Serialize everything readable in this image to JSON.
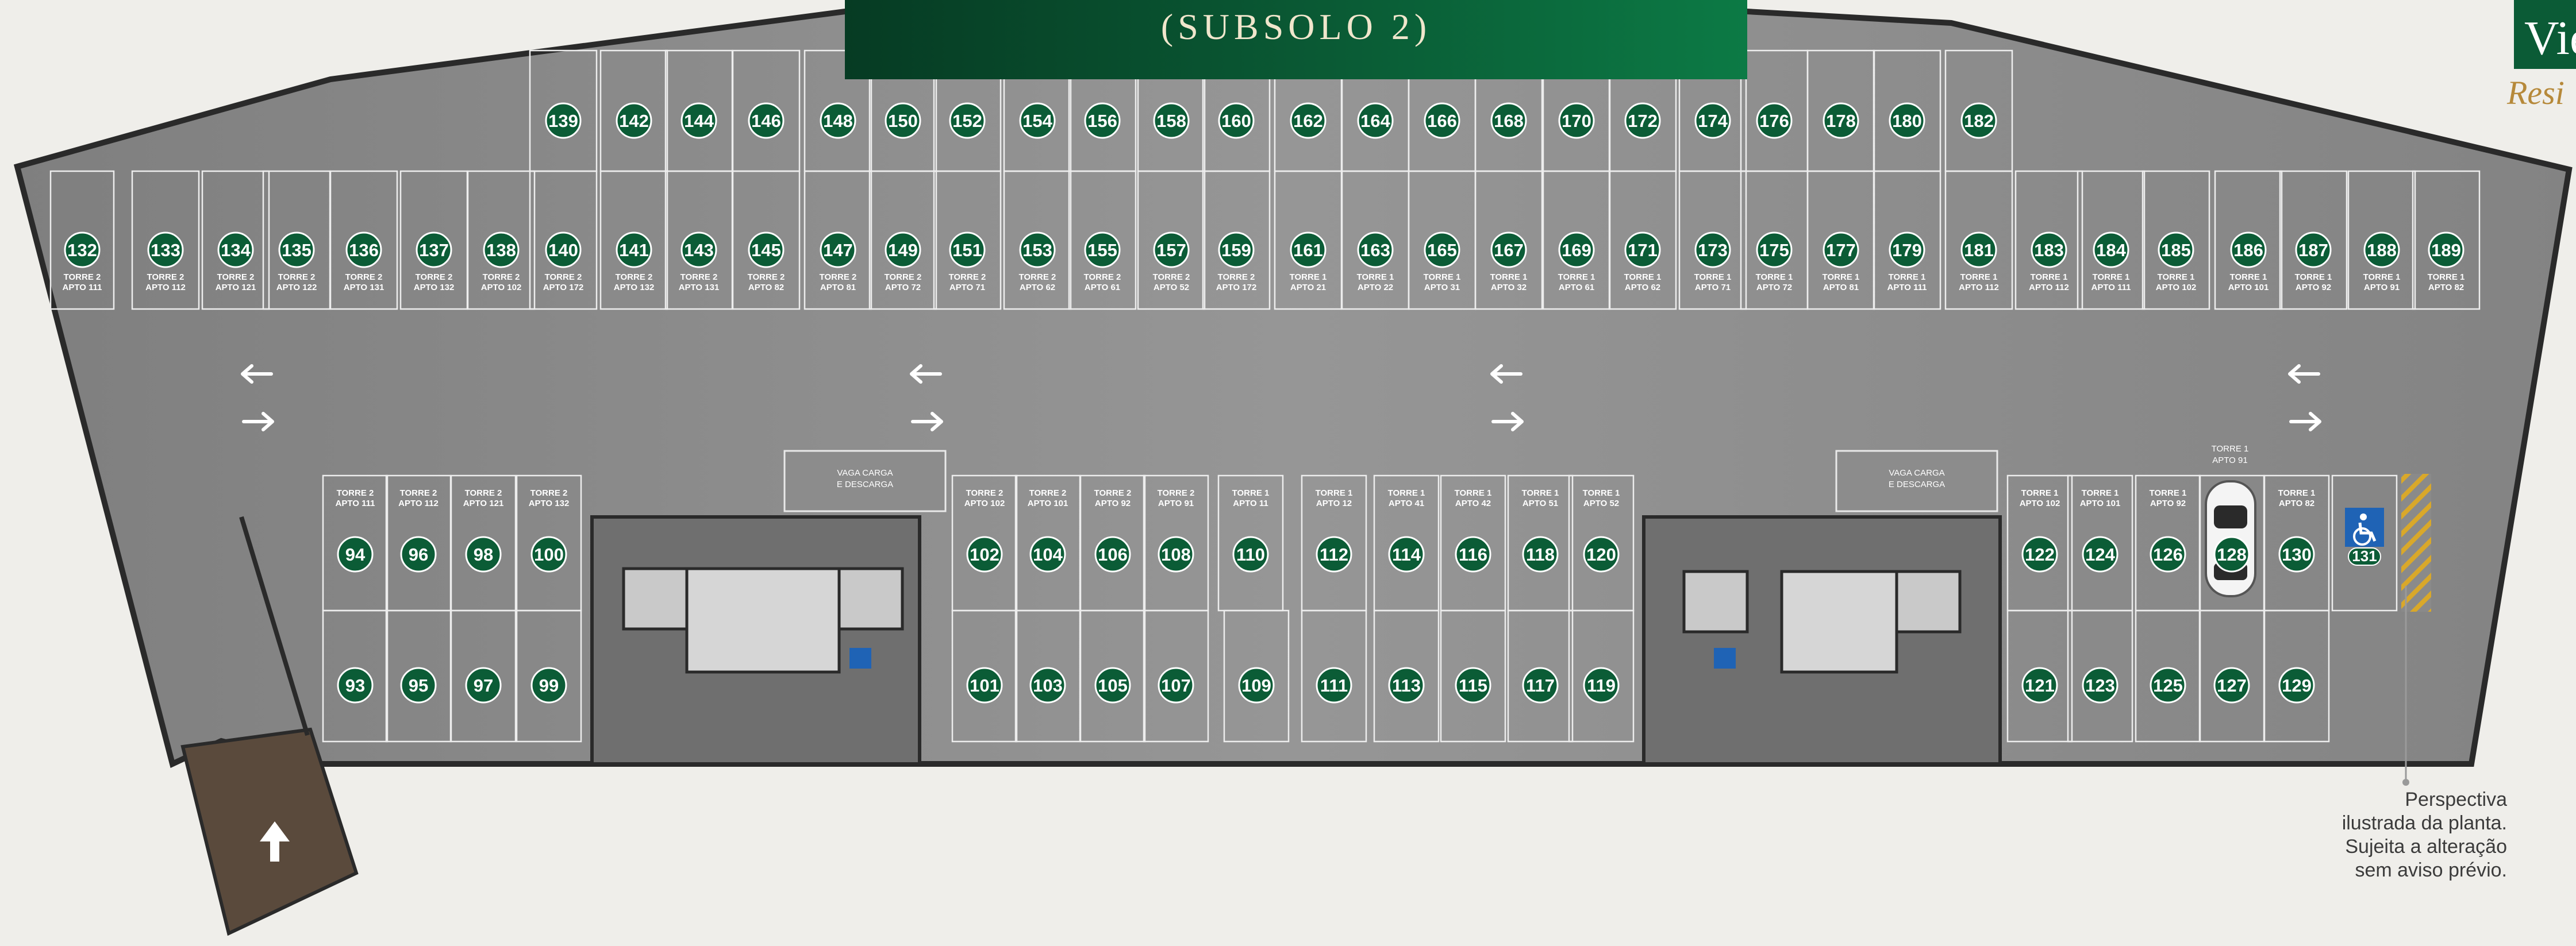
{
  "header": {
    "title": "(SUBSOLO 2)",
    "brand_mark": "Vie",
    "brand_script": "Resi"
  },
  "note": {
    "lines": [
      "Perspectiva",
      "ilustrada da planta.",
      "Sujeita a alteração",
      "sem aviso prévio."
    ]
  },
  "colors": {
    "badge": "#0b5c36",
    "floor": "#8e8e8e",
    "background": "#efeeea",
    "accent_gold": "#b6893a",
    "accessible_blue": "#1f63b5",
    "ramp": "#5a4a3c"
  },
  "labels": {
    "loading": [
      "VAGA CARGA",
      "E DESCARGA"
    ],
    "car_tag": [
      "TORRE 1",
      "APTO 91"
    ]
  },
  "spots": {
    "top_back": [
      {
        "n": "139"
      },
      {
        "n": "142"
      },
      {
        "n": "144"
      },
      {
        "n": "146"
      },
      {
        "n": "148"
      },
      {
        "n": "150"
      },
      {
        "n": "152"
      },
      {
        "n": "154"
      },
      {
        "n": "156"
      },
      {
        "n": "158"
      },
      {
        "n": "160"
      },
      {
        "n": "162"
      },
      {
        "n": "164"
      },
      {
        "n": "166"
      },
      {
        "n": "168"
      },
      {
        "n": "170"
      },
      {
        "n": "172"
      },
      {
        "n": "174"
      },
      {
        "n": "176"
      },
      {
        "n": "178"
      },
      {
        "n": "180"
      },
      {
        "n": "182"
      }
    ],
    "top_front": [
      {
        "n": "132",
        "t": "TORRE 2",
        "a": "APTO 111"
      },
      {
        "n": "133",
        "t": "TORRE 2",
        "a": "APTO 112"
      },
      {
        "n": "134",
        "t": "TORRE 2",
        "a": "APTO 121"
      },
      {
        "n": "135",
        "t": "TORRE 2",
        "a": "APTO 122"
      },
      {
        "n": "136",
        "t": "TORRE 2",
        "a": "APTO 131"
      },
      {
        "n": "137",
        "t": "TORRE 2",
        "a": "APTO 132"
      },
      {
        "n": "138",
        "t": "TORRE 2",
        "a": "APTO 102"
      },
      {
        "n": "140",
        "t": "TORRE 2",
        "a": "APTO 172"
      },
      {
        "n": "141",
        "t": "TORRE 2",
        "a": "APTO 132"
      },
      {
        "n": "143",
        "t": "TORRE 2",
        "a": "APTO 131"
      },
      {
        "n": "145",
        "t": "TORRE 2",
        "a": "APTO 82"
      },
      {
        "n": "147",
        "t": "TORRE 2",
        "a": "APTO 81"
      },
      {
        "n": "149",
        "t": "TORRE 2",
        "a": "APTO 72"
      },
      {
        "n": "151",
        "t": "TORRE 2",
        "a": "APTO 71"
      },
      {
        "n": "153",
        "t": "TORRE 2",
        "a": "APTO 62"
      },
      {
        "n": "155",
        "t": "TORRE 2",
        "a": "APTO 61"
      },
      {
        "n": "157",
        "t": "TORRE 2",
        "a": "APTO 52"
      },
      {
        "n": "159",
        "t": "TORRE 2",
        "a": "APTO 172"
      },
      {
        "n": "161",
        "t": "TORRE 1",
        "a": "APTO 21"
      },
      {
        "n": "163",
        "t": "TORRE 1",
        "a": "APTO 22"
      },
      {
        "n": "165",
        "t": "TORRE 1",
        "a": "APTO 31"
      },
      {
        "n": "167",
        "t": "TORRE 1",
        "a": "APTO 32"
      },
      {
        "n": "169",
        "t": "TORRE 1",
        "a": "APTO 61"
      },
      {
        "n": "171",
        "t": "TORRE 1",
        "a": "APTO 62"
      },
      {
        "n": "173",
        "t": "TORRE 1",
        "a": "APTO 71"
      },
      {
        "n": "175",
        "t": "TORRE 1",
        "a": "APTO 72"
      },
      {
        "n": "177",
        "t": "TORRE 1",
        "a": "APTO 81"
      },
      {
        "n": "179",
        "t": "TORRE 1",
        "a": "APTO 111"
      },
      {
        "n": "181",
        "t": "TORRE 1",
        "a": "APTO 112"
      },
      {
        "n": "183",
        "t": "TORRE 1",
        "a": "APTO 112"
      },
      {
        "n": "184",
        "t": "TORRE 1",
        "a": "APTO 111"
      },
      {
        "n": "185",
        "t": "TORRE 1",
        "a": "APTO 102"
      },
      {
        "n": "186",
        "t": "TORRE 1",
        "a": "APTO 101"
      },
      {
        "n": "187",
        "t": "TORRE 1",
        "a": "APTO 92"
      },
      {
        "n": "188",
        "t": "TORRE 1",
        "a": "APTO 91"
      },
      {
        "n": "189",
        "t": "TORRE 1",
        "a": "APTO 82"
      }
    ],
    "bottom_upper": [
      {
        "n": "94",
        "t": "TORRE 2",
        "a": "APTO 111"
      },
      {
        "n": "96",
        "t": "TORRE 2",
        "a": "APTO 112"
      },
      {
        "n": "98",
        "t": "TORRE 2",
        "a": "APTO 121"
      },
      {
        "n": "100",
        "t": "TORRE 2",
        "a": "APTO 132"
      },
      {
        "n": "102",
        "t": "TORRE 2",
        "a": "APTO 102"
      },
      {
        "n": "104",
        "t": "TORRE 2",
        "a": "APTO 101"
      },
      {
        "n": "106",
        "t": "TORRE 2",
        "a": "APTO 92"
      },
      {
        "n": "108",
        "t": "TORRE 2",
        "a": "APTO 91"
      },
      {
        "n": "110",
        "t": "TORRE 1",
        "a": "APTO 11"
      },
      {
        "n": "112",
        "t": "TORRE 1",
        "a": "APTO 12"
      },
      {
        "n": "114",
        "t": "TORRE 1",
        "a": "APTO 41"
      },
      {
        "n": "116",
        "t": "TORRE 1",
        "a": "APTO 42"
      },
      {
        "n": "118",
        "t": "TORRE 1",
        "a": "APTO 51"
      },
      {
        "n": "120",
        "t": "TORRE 1",
        "a": "APTO 52"
      },
      {
        "n": "122",
        "t": "TORRE 1",
        "a": "APTO 102"
      },
      {
        "n": "124",
        "t": "TORRE 1",
        "a": "APTO 101"
      },
      {
        "n": "126",
        "t": "TORRE 1",
        "a": "APTO 92"
      },
      {
        "n": "128",
        "t": "",
        "a": ""
      },
      {
        "n": "130",
        "t": "TORRE 1",
        "a": "APTO 82"
      },
      {
        "n": "131",
        "t": "",
        "a": ""
      }
    ],
    "bottom_lower": [
      {
        "n": "93"
      },
      {
        "n": "95"
      },
      {
        "n": "97"
      },
      {
        "n": "99"
      },
      {
        "n": "101"
      },
      {
        "n": "103"
      },
      {
        "n": "105"
      },
      {
        "n": "107"
      },
      {
        "n": "109"
      },
      {
        "n": "111"
      },
      {
        "n": "113"
      },
      {
        "n": "115"
      },
      {
        "n": "117"
      },
      {
        "n": "119"
      },
      {
        "n": "121"
      },
      {
        "n": "123"
      },
      {
        "n": "125"
      },
      {
        "n": "127"
      },
      {
        "n": "129"
      }
    ]
  }
}
